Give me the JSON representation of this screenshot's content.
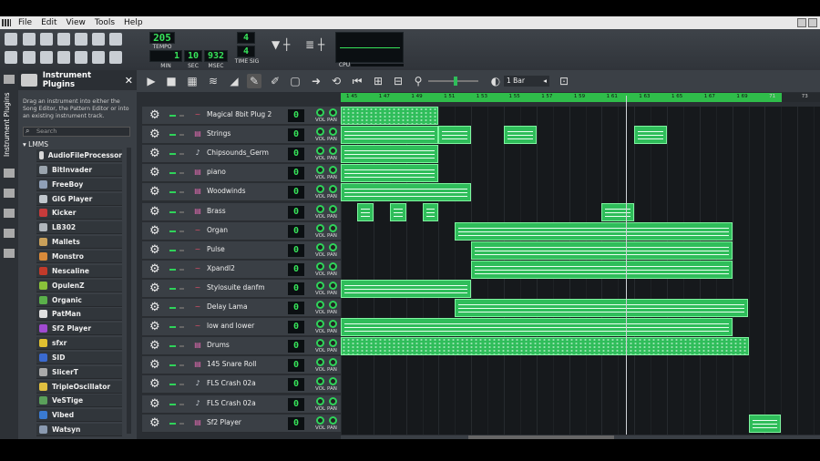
{
  "menu": [
    "File",
    "Edit",
    "View",
    "Tools",
    "Help"
  ],
  "toolbar": {
    "tempo": "205",
    "tempo_label": "TEMPO",
    "min": "1",
    "sec": "10",
    "msec": "932",
    "min_label": "MIN",
    "sec_label": "SEC",
    "msec_label": "MSEC",
    "timesig_num": "4",
    "timesig_den": "4",
    "timesig_label": "TIME SIG",
    "cpu_label": "CPU"
  },
  "plugins_panel": {
    "title": "Instrument Plugins",
    "description": "Drag an instrument into either the Song Editor, the Pattern Editor or into an existing instrument track.",
    "search_placeholder": "Search",
    "group": "LMMS",
    "items": [
      {
        "label": "AudioFileProcessor",
        "color": "#d7d7d7"
      },
      {
        "label": "BitInvader",
        "color": "#9aa4ad"
      },
      {
        "label": "FreeBoy",
        "color": "#8fa0b8"
      },
      {
        "label": "GIG Player",
        "color": "#c0c6cc"
      },
      {
        "label": "Kicker",
        "color": "#c63b3b"
      },
      {
        "label": "LB302",
        "color": "#b0b6bc"
      },
      {
        "label": "Mallets",
        "color": "#c9a05a"
      },
      {
        "label": "Monstro",
        "color": "#d98a3a"
      },
      {
        "label": "Nescaline",
        "color": "#c23a2a"
      },
      {
        "label": "OpulenZ",
        "color": "#8ac23a"
      },
      {
        "label": "Organic",
        "color": "#5ab04a"
      },
      {
        "label": "PatMan",
        "color": "#e0e0e0"
      },
      {
        "label": "Sf2 Player",
        "color": "#a04ad0"
      },
      {
        "label": "sfxr",
        "color": "#e0c030"
      },
      {
        "label": "SID",
        "color": "#3a6ad0"
      },
      {
        "label": "SlicerT",
        "color": "#aaaaaa"
      },
      {
        "label": "TripleOscillator",
        "color": "#e0c040"
      },
      {
        "label": "VeSTige",
        "color": "#5aa05a"
      },
      {
        "label": "Vibed",
        "color": "#3a7ad0"
      },
      {
        "label": "Watsyn",
        "color": "#8a9ab0"
      }
    ]
  },
  "song_editor": {
    "zoom_label": "1 Bar",
    "vol_label": "VOL",
    "pan_label": "PAN",
    "timeline_ticks": [
      "1 45",
      "1 47",
      "1 49",
      "1 51",
      "1 53",
      "1 55",
      "1 57",
      "1 59",
      "1 61",
      "1 63",
      "1 65",
      "1 67",
      "1 69",
      "71",
      "73"
    ],
    "tracks": [
      {
        "name": "Magical 8bit Plug 2",
        "icon": "osc",
        "value": "0"
      },
      {
        "name": "Strings",
        "icon": "sf2",
        "value": "0"
      },
      {
        "name": "Chipsounds_Germ",
        "icon": "note",
        "value": "0"
      },
      {
        "name": "piano",
        "icon": "sf2",
        "value": "0"
      },
      {
        "name": "Woodwinds",
        "icon": "sf2",
        "value": "0"
      },
      {
        "name": "Brass",
        "icon": "sf2",
        "value": "0"
      },
      {
        "name": "Organ",
        "icon": "osc",
        "value": "0"
      },
      {
        "name": "Pulse",
        "icon": "osc",
        "value": "0"
      },
      {
        "name": "Xpandl2",
        "icon": "osc",
        "value": "0"
      },
      {
        "name": "Stylosuite danfm",
        "icon": "osc",
        "value": "0"
      },
      {
        "name": "Delay Lama",
        "icon": "osc",
        "value": "0"
      },
      {
        "name": "low and lower",
        "icon": "osc",
        "value": "0"
      },
      {
        "name": "Drums",
        "icon": "sf2",
        "value": "0"
      },
      {
        "name": "145 Snare Roll",
        "icon": "sf2",
        "value": "0"
      },
      {
        "name": "FLS Crash 02a",
        "icon": "note",
        "value": "0"
      },
      {
        "name": "FLS Crash 02a",
        "icon": "note",
        "value": "0"
      },
      {
        "name": "Sf2 Player",
        "icon": "sf2",
        "value": "0"
      }
    ]
  },
  "colors": {
    "accent": "#2fbd5a",
    "lcd": "#37e35a",
    "bg": "#2a2e33"
  }
}
